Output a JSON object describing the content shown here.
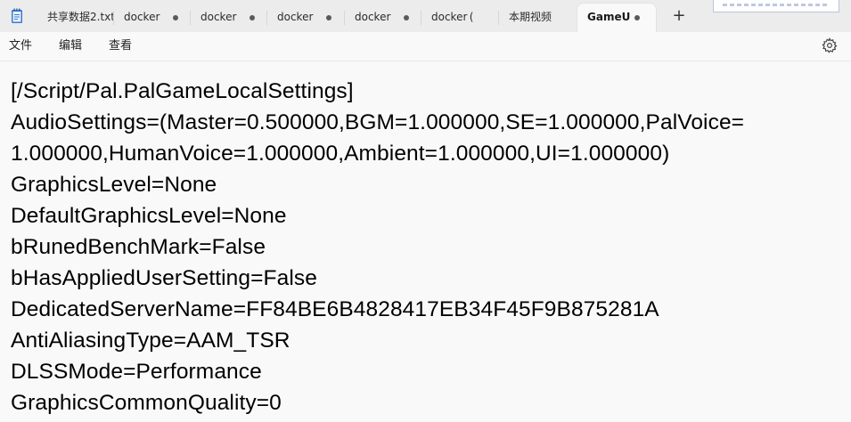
{
  "window": {
    "app_icon": "notepad-icon",
    "tabs": [
      {
        "label": "共享数据2.txt",
        "modified": false,
        "active": false
      },
      {
        "label": "docker",
        "modified": true,
        "active": false
      },
      {
        "label": "docker",
        "modified": true,
        "active": false
      },
      {
        "label": "docker",
        "modified": true,
        "active": false
      },
      {
        "label": "docker",
        "modified": true,
        "active": false
      },
      {
        "label": "docker (",
        "modified": false,
        "active": false
      },
      {
        "label": "本期视频",
        "modified": false,
        "active": false
      },
      {
        "label": "GameU",
        "modified": true,
        "active": true
      }
    ],
    "new_tab_label": "+",
    "accent_color": "#ffffff"
  },
  "menu": {
    "file": "文件",
    "edit": "编辑",
    "view": "查看",
    "settings_icon": "gear-icon"
  },
  "editor": {
    "lines": [
      "[/Script/Pal.PalGameLocalSettings]",
      "AudioSettings=(Master=0.500000,BGM=1.000000,SE=1.000000,PalVoice=",
      "1.000000,HumanVoice=1.000000,Ambient=1.000000,UI=1.000000)",
      "GraphicsLevel=None",
      "DefaultGraphicsLevel=None",
      "bRunedBenchMark=False",
      "bHasAppliedUserSetting=False",
      "DedicatedServerName=FF84BE6B4828417EB34F45F9B875281A",
      "AntiAliasingType=AAM_TSR",
      "DLSSMode=Performance",
      "GraphicsCommonQuality=0"
    ]
  }
}
